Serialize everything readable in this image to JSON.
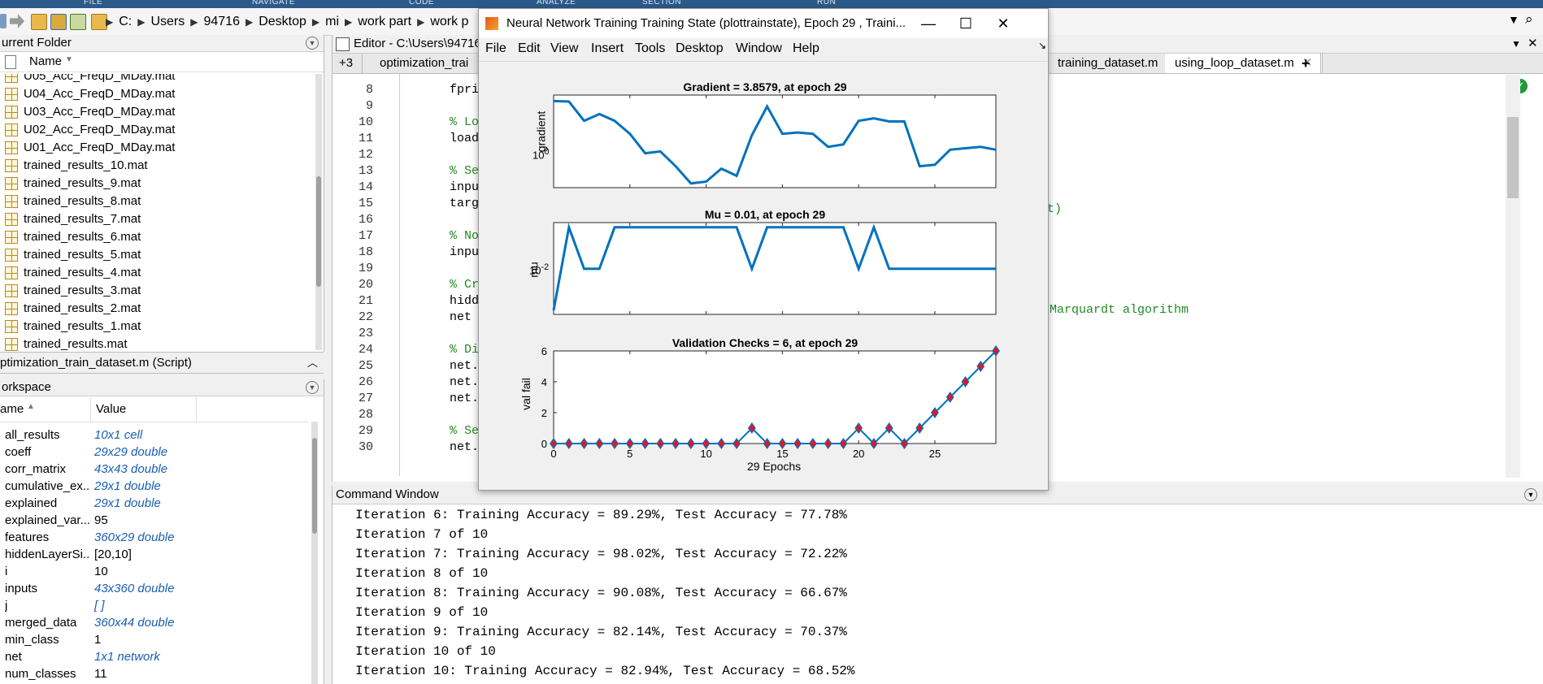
{
  "ribbon": {
    "labels": [
      "FILE",
      "NAVIGATE",
      "CODE",
      "ANALYZE",
      "SECTION",
      "RUN"
    ]
  },
  "address": {
    "crumbs": [
      "C:",
      "Users",
      "94716",
      "Desktop",
      "mi",
      "work part",
      "work p"
    ]
  },
  "folder": {
    "title": "urrent Folder",
    "col_name": "Name",
    "files": [
      "U05_Acc_FreqD_MDay.mat",
      "U04_Acc_FreqD_MDay.mat",
      "U03_Acc_FreqD_MDay.mat",
      "U02_Acc_FreqD_MDay.mat",
      "U01_Acc_FreqD_MDay.mat",
      "trained_results_10.mat",
      "trained_results_9.mat",
      "trained_results_8.mat",
      "trained_results_7.mat",
      "trained_results_6.mat",
      "trained_results_5.mat",
      "trained_results_4.mat",
      "trained_results_3.mat",
      "trained_results_2.mat",
      "trained_results_1.mat",
      "trained_results.mat"
    ]
  },
  "details": {
    "label": "ptimization_train_dataset.m  (Script)"
  },
  "workspace": {
    "title": "orkspace",
    "col_name": "ame",
    "col_value": "Value",
    "vars": [
      {
        "name": "all_results",
        "value": "10x1 cell",
        "blue": true
      },
      {
        "name": "coeff",
        "value": "29x29 double",
        "blue": true
      },
      {
        "name": "corr_matrix",
        "value": "43x43 double",
        "blue": true
      },
      {
        "name": "cumulative_ex...",
        "value": "29x1 double",
        "blue": true
      },
      {
        "name": "explained",
        "value": "29x1 double",
        "blue": true
      },
      {
        "name": "explained_var...",
        "value": "95",
        "blue": false
      },
      {
        "name": "features",
        "value": "360x29 double",
        "blue": true
      },
      {
        "name": "hiddenLayerSi...",
        "value": "[20,10]",
        "blue": false
      },
      {
        "name": "i",
        "value": "10",
        "blue": false
      },
      {
        "name": "inputs",
        "value": "43x360 double",
        "blue": true
      },
      {
        "name": "j",
        "value": "[ ]",
        "blue": true
      },
      {
        "name": "merged_data",
        "value": "360x44 double",
        "blue": true
      },
      {
        "name": "min_class",
        "value": "1",
        "blue": false
      },
      {
        "name": "net",
        "value": "1x1 network",
        "blue": true
      },
      {
        "name": "num_classes",
        "value": "11",
        "blue": false
      }
    ]
  },
  "editor": {
    "title": "Editor - C:\\Users\\94716",
    "tabs": [
      "+3",
      "optimization_trai",
      "training_dataset.m",
      "using_loop_dataset.m",
      "+"
    ],
    "lines": [
      {
        "n": "8",
        "code": "fpri",
        "comment": false
      },
      {
        "n": "9",
        "code": "",
        "comment": false
      },
      {
        "n": "10",
        "code": "% Lo",
        "comment": true
      },
      {
        "n": "11",
        "code": "load",
        "comment": false
      },
      {
        "n": "12",
        "code": "",
        "comment": false
      },
      {
        "n": "13",
        "code": "% Se",
        "comment": true
      },
      {
        "n": "14",
        "code": "inpu",
        "comment": false
      },
      {
        "n": "15",
        "code": "targ",
        "comment": false
      },
      {
        "n": "16",
        "code": "",
        "comment": false
      },
      {
        "n": "17",
        "code": "% No",
        "comment": true
      },
      {
        "n": "18",
        "code": "inpu",
        "comment": false
      },
      {
        "n": "19",
        "code": "",
        "comment": false
      },
      {
        "n": "20",
        "code": "% Cr",
        "comment": true
      },
      {
        "n": "21",
        "code": "hidd",
        "comment": false
      },
      {
        "n": "22",
        "code": "net",
        "comment": false
      },
      {
        "n": "23",
        "code": "",
        "comment": false
      },
      {
        "n": "24",
        "code": "% Di",
        "comment": true
      },
      {
        "n": "25",
        "code": "net.",
        "comment": false
      },
      {
        "n": "26",
        "code": "net.",
        "comment": false
      },
      {
        "n": "27",
        "code": "net.",
        "comment": false
      },
      {
        "n": "28",
        "code": "",
        "comment": false
      },
      {
        "n": "29",
        "code": "% Se",
        "comment": true
      },
      {
        "n": "30",
        "code": "net.",
        "comment": false
      }
    ],
    "tail_15": "rmat)",
    "tail_22": "Marquardt algorithm"
  },
  "command": {
    "title": "Command Window",
    "lines": [
      "Iteration 6: Training Accuracy = 89.29%, Test Accuracy = 77.78%",
      "Iteration 7 of 10",
      "Iteration 7: Training Accuracy = 98.02%, Test Accuracy = 72.22%",
      "Iteration 8 of 10",
      "Iteration 8: Training Accuracy = 90.08%, Test Accuracy = 66.67%",
      "Iteration 9 of 10",
      "Iteration 9: Training Accuracy = 82.14%, Test Accuracy = 70.37%",
      "Iteration 10 of 10",
      "Iteration 10: Training Accuracy = 82.94%, Test Accuracy = 68.52%"
    ]
  },
  "figure": {
    "title": "Neural Network Training Training State (plottrainstate), Epoch 29 , Traini...",
    "menu": [
      "File",
      "Edit",
      "View",
      "Insert",
      "Tools",
      "Desktop",
      "Window",
      "Help"
    ],
    "colors": {
      "line": "#0072bd",
      "marker_fill": "#e8141e"
    }
  },
  "chart_data": [
    {
      "type": "line",
      "title": "Gradient = 3.8579, at epoch 29",
      "ylabel": "gradient",
      "yscale": "log",
      "ytick_labels": [
        "10^0"
      ],
      "x": [
        0,
        1,
        2,
        3,
        4,
        5,
        6,
        7,
        8,
        9,
        10,
        11,
        12,
        13,
        14,
        15,
        16,
        17,
        18,
        19,
        20,
        21,
        22,
        23,
        24,
        25,
        26,
        27,
        28,
        29
      ],
      "values": [
        80,
        78,
        28,
        40,
        28,
        14,
        5,
        5.5,
        2.5,
        1,
        1.1,
        2.2,
        1.5,
        13,
        60,
        14,
        15,
        14,
        7,
        8,
        28,
        32,
        27,
        27,
        2.5,
        2.7,
        6,
        6.5,
        7,
        6
      ]
    },
    {
      "type": "line",
      "title": "Mu = 0.01, at epoch 29",
      "ylabel": "mu",
      "yscale": "log",
      "ytick_labels": [
        "10^-2"
      ],
      "x": [
        0,
        1,
        2,
        3,
        4,
        5,
        6,
        7,
        8,
        9,
        10,
        11,
        12,
        13,
        14,
        15,
        16,
        17,
        18,
        19,
        20,
        21,
        22,
        23,
        24,
        25,
        26,
        27,
        28,
        29
      ],
      "values": [
        0.001,
        0.1,
        0.01,
        0.01,
        0.1,
        0.1,
        0.1,
        0.1,
        0.1,
        0.1,
        0.1,
        0.1,
        0.1,
        0.01,
        0.1,
        0.1,
        0.1,
        0.1,
        0.1,
        0.1,
        0.01,
        0.1,
        0.01,
        0.01,
        0.01,
        0.01,
        0.01,
        0.01,
        0.01,
        0.01
      ]
    },
    {
      "type": "scatter",
      "title": "Validation Checks = 6, at epoch 29",
      "xlabel": "29 Epochs",
      "ylabel": "val fail",
      "xlim": [
        0,
        29
      ],
      "ylim": [
        0,
        6
      ],
      "xticks": [
        0,
        5,
        10,
        15,
        20,
        25
      ],
      "yticks": [
        0,
        2,
        4,
        6
      ],
      "x": [
        0,
        1,
        2,
        3,
        4,
        5,
        6,
        7,
        8,
        9,
        10,
        11,
        12,
        13,
        14,
        15,
        16,
        17,
        18,
        19,
        20,
        21,
        22,
        23,
        24,
        25,
        26,
        27,
        28,
        29
      ],
      "values": [
        0,
        0,
        0,
        0,
        0,
        0,
        0,
        0,
        0,
        0,
        0,
        0,
        0,
        1,
        0,
        0,
        0,
        0,
        0,
        0,
        1,
        0,
        1,
        0,
        1,
        2,
        3,
        4,
        5,
        6
      ]
    }
  ]
}
